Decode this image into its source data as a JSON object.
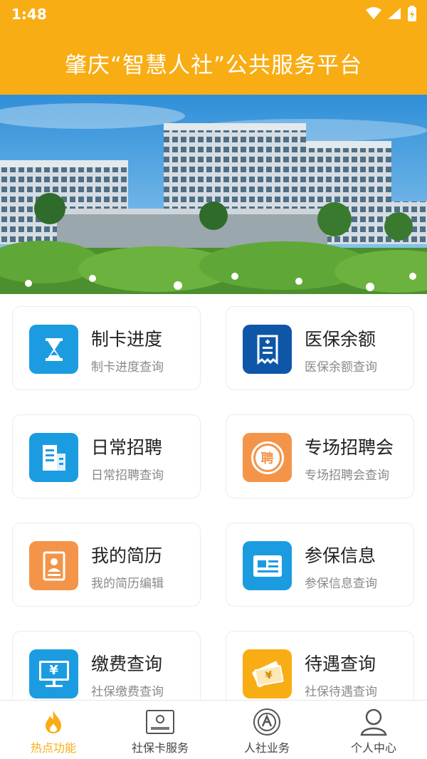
{
  "status": {
    "time": "1:48"
  },
  "header": {
    "title": "肇庆“智慧人社”公共服务平台"
  },
  "cards": [
    {
      "title": "制卡进度",
      "subtitle": "制卡进度查询",
      "icon": "hourglass-icon",
      "color": "#1c9ce0"
    },
    {
      "title": "医保余额",
      "subtitle": "医保余额查询",
      "icon": "receipt-icon",
      "color": "#0e57a8"
    },
    {
      "title": "日常招聘",
      "subtitle": "日常招聘查询",
      "icon": "building-icon",
      "color": "#1c9ce0"
    },
    {
      "title": "专场招聘会",
      "subtitle": "专场招聘会查询",
      "icon": "hire-badge-icon",
      "color": "#f39449",
      "badge": "聘"
    },
    {
      "title": "我的简历",
      "subtitle": "我的简历编辑",
      "icon": "resume-icon",
      "color": "#f39449"
    },
    {
      "title": "参保信息",
      "subtitle": "参保信息查询",
      "icon": "id-card-icon",
      "color": "#1c9ce0"
    },
    {
      "title": "缴费查询",
      "subtitle": "社保缴费查询",
      "icon": "payment-monitor-icon",
      "color": "#1c9ce0",
      "badge": "¥"
    },
    {
      "title": "待遇查询",
      "subtitle": "社保待遇查询",
      "icon": "money-bills-icon",
      "color": "#f9ad14",
      "badge": "¥"
    }
  ],
  "tabs": [
    {
      "label": "热点功能",
      "icon": "flame-icon",
      "active": true
    },
    {
      "label": "社保卡服务",
      "icon": "social-security-card-icon",
      "active": false
    },
    {
      "label": "人社业务",
      "icon": "emblem-icon",
      "active": false
    },
    {
      "label": "个人中心",
      "icon": "user-icon",
      "active": false
    }
  ],
  "colors": {
    "accent": "#f9ad14",
    "blue": "#1c9ce0",
    "navy": "#0e57a8",
    "orange": "#f39449"
  }
}
